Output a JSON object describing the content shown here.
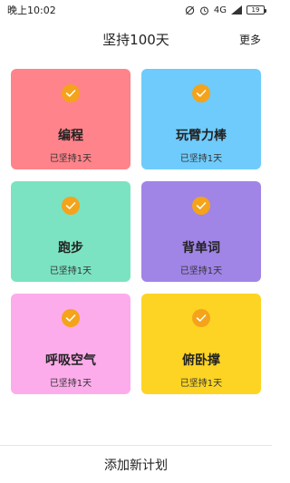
{
  "status_bar": {
    "time": "晚上10:02",
    "network": "4G",
    "battery_level": "19"
  },
  "nav": {
    "title": "坚持100天",
    "more": "更多"
  },
  "colors": {
    "check": "#f4a31a"
  },
  "cards": [
    {
      "name": "编程",
      "days": "已坚持1天",
      "color": "#ff838a"
    },
    {
      "name": "玩臂力棒",
      "days": "已坚持1天",
      "color": "#6fcbfb"
    },
    {
      "name": "跑步",
      "days": "已坚持1天",
      "color": "#7be3c1"
    },
    {
      "name": "背单词",
      "days": "已坚持1天",
      "color": "#a084e6"
    },
    {
      "name": "呼吸空气",
      "days": "已坚持1天",
      "color": "#fdaceb"
    },
    {
      "name": "俯卧撑",
      "days": "已坚持1天",
      "color": "#fdd423"
    }
  ],
  "bottom": {
    "add_label": "添加新计划"
  }
}
